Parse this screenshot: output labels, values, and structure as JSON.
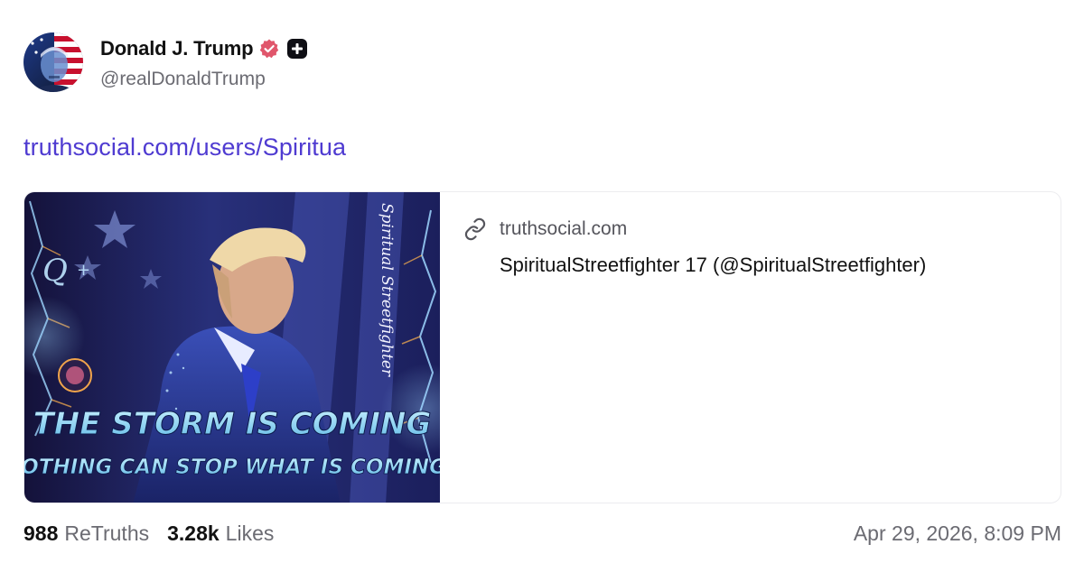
{
  "author": {
    "display_name": "Donald J. Trump",
    "handle": "@realDonaldTrump",
    "verified_icon": "verified-badge-icon",
    "plus_icon": "plus-badge-icon",
    "verified_color": "#e0566b"
  },
  "post": {
    "link_text": "truthsocial.com/users/Spiritua",
    "link_color": "#4f3bd1"
  },
  "card": {
    "domain": "truthsocial.com",
    "title": "SpiritualStreetfighter 17 (@SpiritualStreetfighter)",
    "image": {
      "headline": "THE STORM IS COMING",
      "subheadline": "NOTHING CAN STOP WHAT IS COMING",
      "side_text": "Spiritual Streetfighter",
      "q_text": "Q",
      "q_plus": "+"
    }
  },
  "stats": {
    "retruths_count": "988",
    "retruths_label": "ReTruths",
    "likes_count": "3.28k",
    "likes_label": "Likes"
  },
  "timestamp": "Apr 29, 2026, 8:09 PM"
}
